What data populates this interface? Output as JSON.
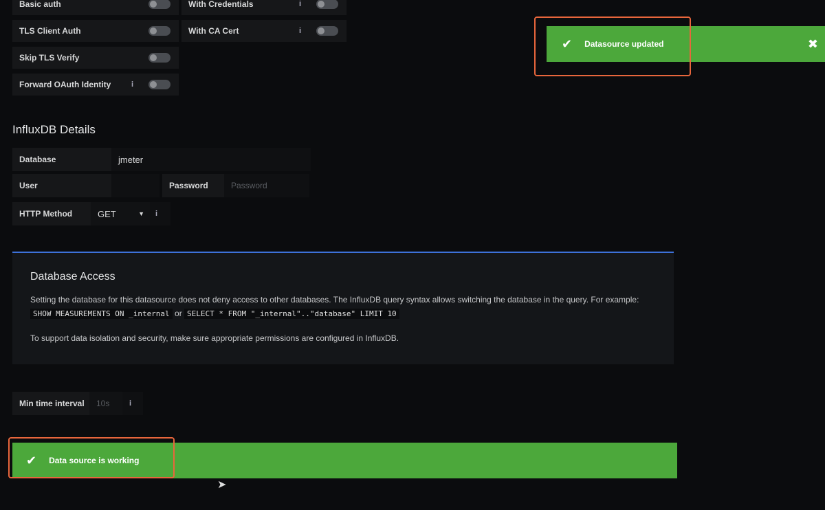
{
  "auth": {
    "basic_auth": "Basic auth",
    "tls_client_auth": "TLS Client Auth",
    "skip_tls_verify": "Skip TLS Verify",
    "forward_oauth": "Forward OAuth Identity",
    "with_credentials": "With Credentials",
    "with_ca_cert": "With CA Cert",
    "info": "i"
  },
  "influx": {
    "title": "InfluxDB Details",
    "database_label": "Database",
    "database_value": "jmeter",
    "user_label": "User",
    "user_value": "",
    "password_label": "Password",
    "password_placeholder": "Password",
    "http_method_label": "HTTP Method",
    "http_method_value": "GET"
  },
  "access": {
    "title": "Database Access",
    "text_1a": "Setting the database for this datasource does not deny access to other databases. The InfluxDB query syntax allows switching the database in the query. For example:",
    "code_1": "SHOW MEASUREMENTS ON _internal",
    "text_or": "or",
    "code_2": "SELECT * FROM \"_internal\"..\"database\" LIMIT 10",
    "text_2": "To support data isolation and security, make sure appropriate permissions are configured in InfluxDB."
  },
  "interval": {
    "label": "Min time interval",
    "placeholder": "10s"
  },
  "alerts": {
    "updated": "Datasource updated",
    "working": "Data source is working",
    "check_glyph": "✔",
    "close_glyph": "✖"
  },
  "colors": {
    "success": "#4ca83b",
    "highlight": "#e8663c",
    "accent": "#3d71d9"
  }
}
